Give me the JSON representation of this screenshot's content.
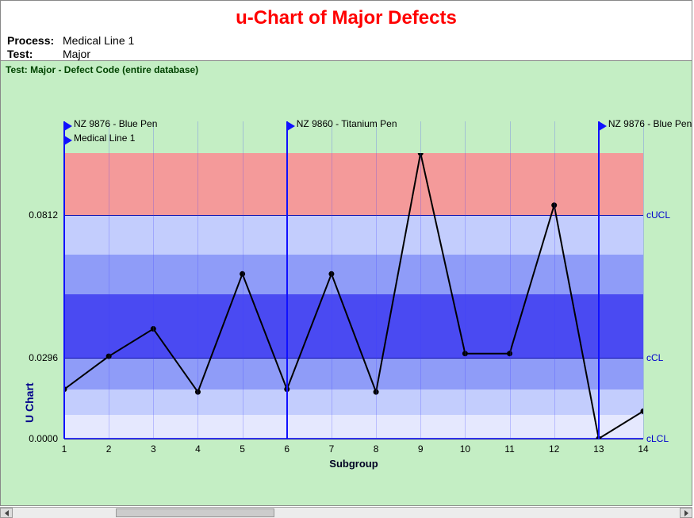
{
  "header": {
    "title": "u-Chart of Major Defects",
    "process_label": "Process:",
    "process_value": "Medical Line 1",
    "test_label": "Test:",
    "test_value": "Major"
  },
  "chart": {
    "subtitle": "Test: Major - Defect Code (entire database)",
    "y_axis_label": "U Chart",
    "x_axis_label": "Subgroup",
    "y_ticks": [
      "0.0000",
      "0.0296",
      "0.0812"
    ],
    "limits": {
      "ucl": "cUCL",
      "cl": "cCL",
      "lcl": "cLCL"
    },
    "annotations": [
      {
        "x": 1,
        "row": 0,
        "text": "NZ 9876 - Blue Pen"
      },
      {
        "x": 1,
        "row": 1,
        "text": "Medical Line 1"
      },
      {
        "x": 6,
        "row": 0,
        "text": "NZ 9860 - Titanium Pen"
      },
      {
        "x": 13,
        "row": 0,
        "text": "NZ 9876 - Blue Pen"
      }
    ]
  },
  "chart_data": {
    "type": "line",
    "title": "u-Chart of Major Defects",
    "xlabel": "Subgroup",
    "ylabel": "U Chart",
    "categories": [
      1,
      2,
      3,
      4,
      5,
      6,
      7,
      8,
      9,
      10,
      11,
      12,
      13,
      14
    ],
    "values": [
      0.018,
      0.03,
      0.04,
      0.017,
      0.06,
      0.018,
      0.06,
      0.017,
      0.104,
      0.031,
      0.031,
      0.085,
      0.0,
      0.01
    ],
    "limits_values": {
      "ucl": 0.0812,
      "cl": 0.0296,
      "lcl": 0.0
    },
    "ylim": [
      0.0,
      0.104
    ]
  }
}
